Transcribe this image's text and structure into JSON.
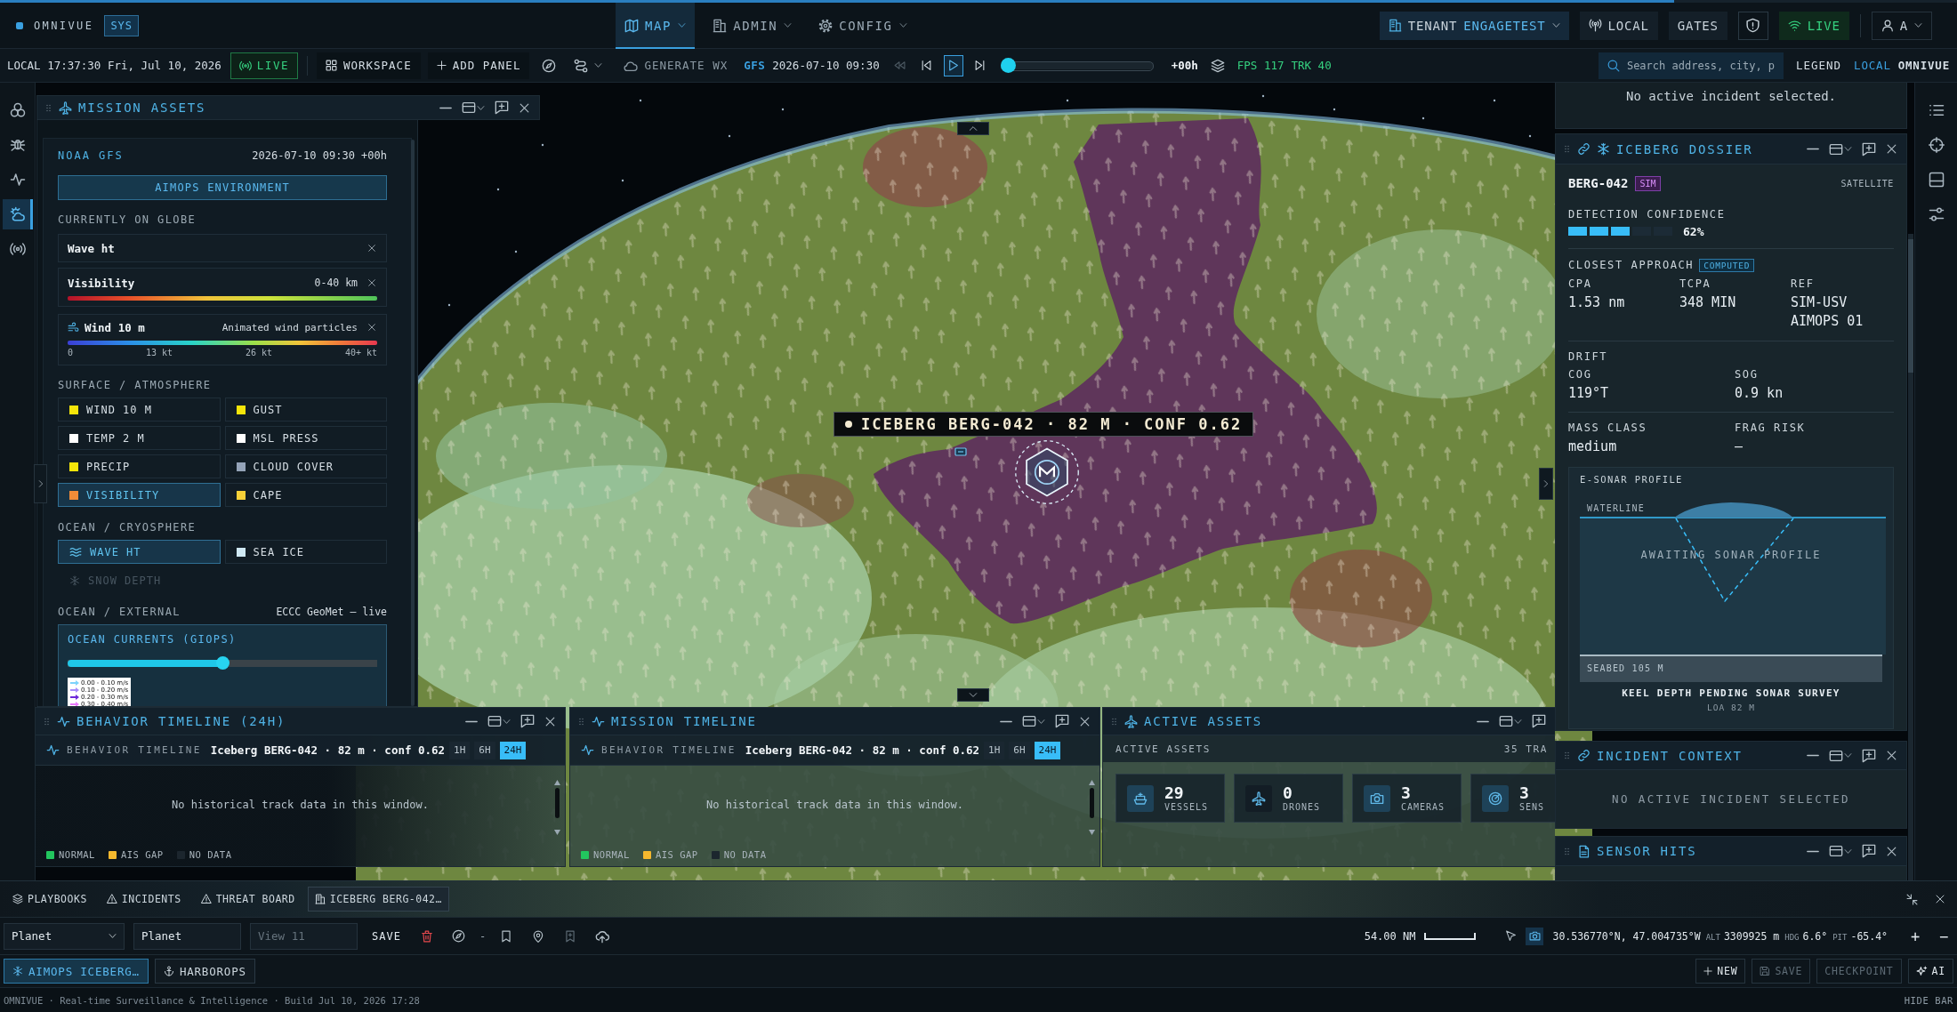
{
  "top_bar": {
    "logo": "OMNIVUE",
    "badge": "SYS",
    "nav": [
      {
        "label": "MAP",
        "kind": "map",
        "selected": true
      },
      {
        "label": "ADMIN",
        "kind": "building",
        "selected": false
      },
      {
        "label": "CONFIG",
        "kind": "gear",
        "selected": false
      }
    ],
    "tenant_label": "TENANT",
    "tenant_value": "ENGAGETEST",
    "local": "LOCAL",
    "gates": "GATES",
    "live": "LIVE",
    "user": "A"
  },
  "toolbar": {
    "clock": "LOCAL 17:37:30 Fri, Jul 10, 2026",
    "live": "LIVE",
    "workspace": "WORKSPACE",
    "add_panel": "ADD PANEL",
    "generate": "GENERATE WX",
    "model": "GFS",
    "model_time": "2026-07-10 09:30",
    "transport": [
      {
        "kind": "rewind",
        "selected": false,
        "disabled": true
      },
      {
        "kind": "skip-back",
        "selected": false,
        "disabled": false
      },
      {
        "kind": "play",
        "selected": true,
        "disabled": false
      },
      {
        "kind": "skip-forward",
        "selected": false,
        "disabled": false
      }
    ],
    "time_slider": {
      "level": 0
    },
    "offset": "+00h",
    "fps": "FPS 117",
    "trk": "TRK 40",
    "search": {
      "placeholder": "Search address, city, p"
    },
    "legend": "LEGEND",
    "sources": [
      {
        "label": "LOCAL",
        "selected": true
      },
      {
        "label": "OMNIVUE",
        "selected": false
      }
    ]
  },
  "left_rail": [
    {
      "kind": "circles",
      "selected": false
    },
    {
      "kind": "bug",
      "selected": false
    },
    {
      "kind": "pulse",
      "selected": false
    },
    {
      "kind": "weather",
      "selected": true
    },
    {
      "kind": "broadcast",
      "selected": false
    }
  ],
  "mission_assets": {
    "title": "MISSION ASSETS",
    "source": "NOAA GFS",
    "timestamp": "2026-07-10 09:30 +00h",
    "environment_button": "AIMOPS ENVIRONMENT",
    "on_globe_heading": "CURRENTLY ON GLOBE",
    "on_globe": [
      {
        "kind": "plain",
        "name": "Wave ht"
      },
      {
        "kind": "ramp",
        "name": "Visibility",
        "range": "0-40 km"
      },
      {
        "kind": "particles",
        "name": "Wind 10 m",
        "note": "Animated wind particles",
        "ticks": [
          "0",
          "13 kt",
          "26 kt",
          "40+ kt"
        ]
      }
    ],
    "groups": [
      {
        "heading": "SURFACE / ATMOSPHERE",
        "layers": [
          {
            "kind": "swatch",
            "label": "WIND 10 M",
            "color": "#f5e50a",
            "selected": false,
            "disabled": false
          },
          {
            "kind": "swatch",
            "label": "GUST",
            "color": "#f5e50a",
            "selected": false,
            "disabled": false
          },
          {
            "kind": "swatch",
            "label": "TEMP 2 M",
            "color": "#ffffff",
            "selected": false,
            "disabled": false
          },
          {
            "kind": "swatch",
            "label": "MSL PRESS",
            "color": "#ffffff",
            "selected": false,
            "disabled": false
          },
          {
            "kind": "swatch",
            "label": "PRECIP",
            "color": "#f5e50a",
            "selected": false,
            "disabled": false
          },
          {
            "kind": "swatch",
            "label": "CLOUD COVER",
            "color": "#94a3b8",
            "selected": false,
            "disabled": false
          },
          {
            "kind": "swatch",
            "label": "VISIBILITY",
            "color": "#f28c38",
            "selected": true,
            "disabled": false
          },
          {
            "kind": "swatch",
            "label": "CAPE",
            "color": "#f7d038",
            "selected": false,
            "disabled": false
          }
        ]
      },
      {
        "heading": "OCEAN / CRYOSPHERE",
        "layers": [
          {
            "kind": "waves",
            "label": "WAVE HT",
            "selected": true,
            "disabled": false
          },
          {
            "kind": "swatch",
            "label": "SEA ICE",
            "color": "#cfe8f3",
            "selected": false,
            "disabled": false
          },
          {
            "kind": "snowflake",
            "label": "SNOW DEPTH",
            "selected": false,
            "disabled": true
          }
        ]
      }
    ],
    "external": {
      "heading": "OCEAN / EXTERNAL",
      "source": "ECCC GeoMet — live",
      "title": "OCEAN CURRENTS (GIOPS)",
      "opacity": {
        "level": 0.5
      },
      "legend": [
        {
          "label": "0.00 - 0.10 m/s",
          "color": "#7dd3fc"
        },
        {
          "label": "0.10 - 0.20 m/s",
          "color": "#a78bfa"
        },
        {
          "label": "0.20 - 0.30 m/s",
          "color": "#6d28d9"
        },
        {
          "label": "0.30 - 0.40 m/s",
          "color": "#e879f9"
        }
      ]
    }
  },
  "map": {
    "callout": "ICEBERG BERG-042 · 82 M · CONF 0.62"
  },
  "timelines": [
    {
      "title": "BEHAVIOR TIMELINE (24H)",
      "label": "BEHAVIOR TIMELINE",
      "subject": "Iceberg BERG-042 · 82 m · conf 0.62",
      "ranges": [
        {
          "label": "1H",
          "selected": false
        },
        {
          "label": "6H",
          "selected": false
        },
        {
          "label": "24H",
          "selected": true
        }
      ],
      "empty": "No historical track data in this window.",
      "legend": [
        {
          "label": "NORMAL",
          "color": "#22c55e"
        },
        {
          "label": "AIS GAP",
          "color": "#f5b82e"
        },
        {
          "label": "NO DATA",
          "color": "#1c262e"
        }
      ]
    },
    {
      "title": "MISSION TIMELINE",
      "label": "BEHAVIOR TIMELINE",
      "subject": "Iceberg BERG-042 · 82 m · conf 0.62",
      "ranges": [
        {
          "label": "1H",
          "selected": false
        },
        {
          "label": "6H",
          "selected": false
        },
        {
          "label": "24H",
          "selected": true
        }
      ],
      "empty": "No historical track data in this window.",
      "legend": [
        {
          "label": "NORMAL",
          "color": "#22c55e"
        },
        {
          "label": "AIS GAP",
          "color": "#f5b82e"
        },
        {
          "label": "NO DATA",
          "color": "#1c262e"
        }
      ]
    }
  ],
  "active_assets": {
    "title": "ACTIVE ASSETS",
    "heading": "ACTIVE ASSETS",
    "count": "35 TRA",
    "cards": [
      {
        "kind": "ship",
        "value": "29",
        "label": "VESSELS"
      },
      {
        "kind": "plane",
        "value": "0",
        "label": "DRONES"
      },
      {
        "kind": "camera",
        "value": "3",
        "label": "CAMERAS"
      },
      {
        "kind": "radar",
        "value": "3",
        "label": "SENS"
      }
    ]
  },
  "incident_banner": "No active incident selected.",
  "dossier": {
    "title": "ICEBERG DOSSIER",
    "id": "BERG-042",
    "badge": "SIM",
    "source": "SATELLITE",
    "confidence_label": "DETECTION CONFIDENCE",
    "confidence": {
      "level": 0.62
    },
    "confidence_value": "62%",
    "approach_heading": "CLOSEST APPROACH",
    "approach_badge": "COMPUTED",
    "approach": [
      {
        "label": "CPA",
        "value": "1.53 nm"
      },
      {
        "label": "TCPA",
        "value": "348 MIN"
      },
      {
        "label": "REF",
        "value": "SIM-USV AIMOPS 01"
      }
    ],
    "drift_heading": "DRIFT",
    "drift": [
      {
        "label": "COG",
        "value": "119°T"
      },
      {
        "label": "SOG",
        "value": "0.9 kn"
      }
    ],
    "mass": [
      {
        "label": "MASS CLASS",
        "value": "medium"
      },
      {
        "label": "FRAG RISK",
        "value": "—"
      }
    ],
    "sonar": {
      "title": "E-SONAR PROFILE",
      "waterline": "WATERLINE",
      "status": "AWAITING SONAR PROFILE",
      "seabed": "SEABED 105 M",
      "caption": "KEEL DEPTH PENDING SONAR SURVEY",
      "subcaption": "LOA 82 M"
    }
  },
  "incident_context": {
    "title": "INCIDENT CONTEXT",
    "message": "NO ACTIVE INCIDENT SELECTED"
  },
  "sensor_hits": {
    "title": "SENSOR HITS"
  },
  "right_rail": [
    {
      "kind": "list"
    },
    {
      "kind": "crosshair"
    },
    {
      "kind": "panel"
    },
    {
      "kind": "sliders"
    }
  ],
  "bottom_tabs": [
    {
      "kind": "layers",
      "label": "PLAYBOOKS",
      "selected": false
    },
    {
      "kind": "warning",
      "label": "INCIDENTS",
      "selected": false
    },
    {
      "kind": "warning",
      "label": "THREAT BOARD",
      "selected": false
    },
    {
      "kind": "building",
      "label": "ICEBERG BERG-042…",
      "selected": true
    }
  ],
  "view_bar": {
    "globe": "Planet",
    "name_field": {
      "value": "Planet"
    },
    "view_field": {
      "placeholder": "View 11"
    },
    "save": "SAVE",
    "dash": "-",
    "scale": "54.00 NM",
    "coords": "30.536770°N, 47.004735°W",
    "readouts": [
      {
        "label": "ALT",
        "value": "3309925 m"
      },
      {
        "label": "HDG",
        "value": "6.6°"
      },
      {
        "label": "PIT",
        "value": "-65.4°"
      }
    ],
    "zoom_in": "+",
    "zoom_out": "−"
  },
  "workspaces": [
    {
      "kind": "snowflake",
      "label": "AIMOPS ICEBERG…",
      "selected": true
    },
    {
      "kind": "anchor",
      "label": "HARBOROPS",
      "selected": false
    }
  ],
  "workspace_actions": [
    {
      "kind": "plus",
      "label": "NEW",
      "disabled": false
    },
    {
      "kind": "disk",
      "label": "SAVE",
      "disabled": true
    },
    {
      "kind": "text",
      "label": "CHECKPOINT",
      "disabled": true
    },
    {
      "kind": "sparkle",
      "label": "AI",
      "disabled": false
    }
  ],
  "status_bar": {
    "text": "OMNIVUE · Real-time Surveillance & Intelligence · Build Jul 10, 2026 17:28",
    "hide": "HIDE BAR"
  }
}
